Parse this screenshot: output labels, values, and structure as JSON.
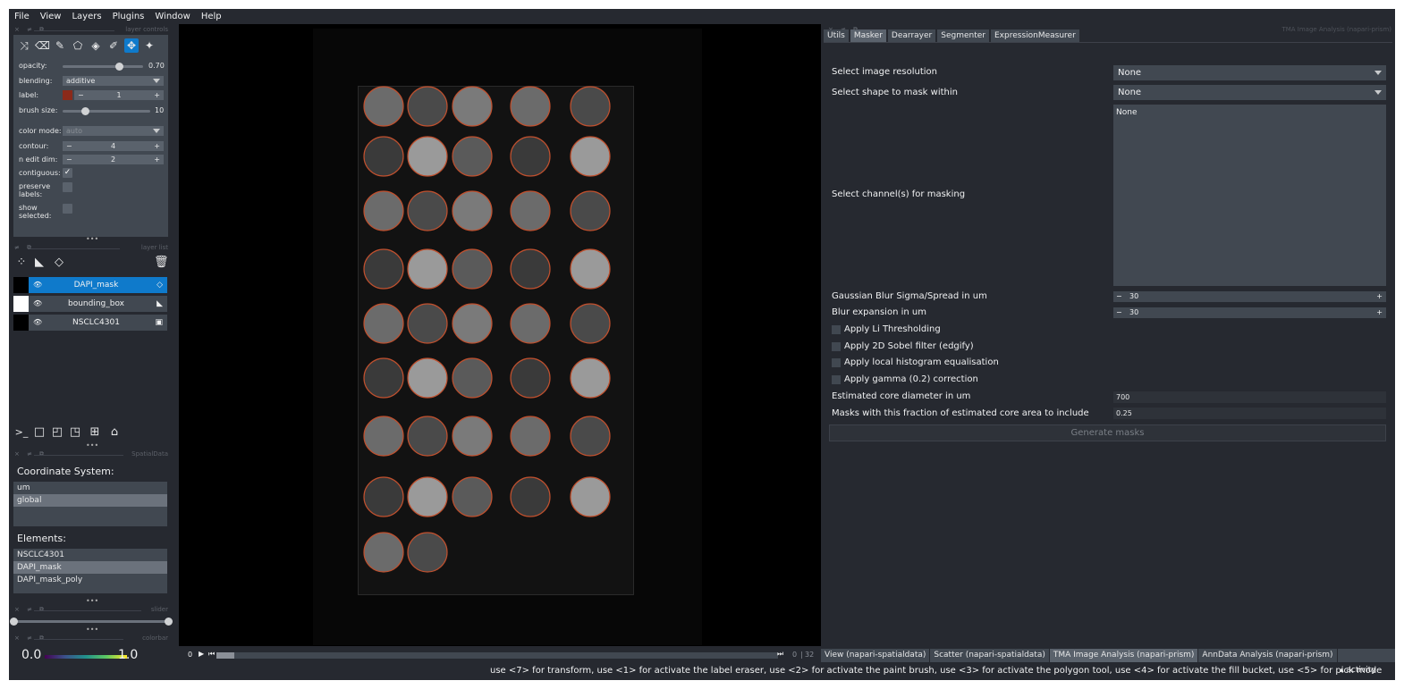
{
  "menu": [
    "File",
    "View",
    "Layers",
    "Plugins",
    "Window",
    "Help"
  ],
  "layer_controls": {
    "title": "layer controls",
    "opacity_label": "opacity:",
    "opacity_value": "0.70",
    "opacity_fraction": 0.7,
    "blending_label": "blending:",
    "blending_value": "additive",
    "label_label": "label:",
    "label_value": "1",
    "label_color": "#8b2a1a",
    "brush_label": "brush size:",
    "brush_value": "10",
    "brush_fraction": 0.25,
    "color_mode_label": "color mode:",
    "color_mode_value": "auto",
    "contour_label": "contour:",
    "contour_value": "4",
    "n_edit_label": "n edit dim:",
    "n_edit_value": "2",
    "contiguous_label": "contiguous:",
    "preserve_label": "preserve labels:",
    "show_selected_label": "show selected:",
    "minus": "−",
    "plus": "+",
    "check": "✓"
  },
  "layer_list": {
    "title": "layer list",
    "layers": [
      {
        "name": "DAPI_mask",
        "type": "labels-icon",
        "selected": true
      },
      {
        "name": "bounding_box",
        "type": "shapes-icon",
        "selected": false
      },
      {
        "name": "NSCLC4301",
        "type": "image-icon",
        "selected": false
      }
    ]
  },
  "spatialdata": {
    "title": "SpatialData",
    "coord_title": "Coordinate System:",
    "coords": [
      "um",
      "global"
    ],
    "coord_selected": "global",
    "elements_title": "Elements:",
    "elements": [
      "NSCLC4301",
      "DAPI_mask",
      "DAPI_mask_poly"
    ],
    "element_selected": "DAPI_mask"
  },
  "slider_dock": {
    "title": "slider"
  },
  "colorbar_dock": {
    "title": "colorbar",
    "min": "0.0",
    "max": "1.0"
  },
  "dims": {
    "start": "0",
    "pos": "0",
    "total": "32",
    "sep": "|"
  },
  "right_dock": {
    "title": "TMA Image Analysis (napari-prism)",
    "tabs": [
      "Utils",
      "Masker",
      "Dearrayer",
      "Segmenter",
      "ExpressionMeasurer"
    ],
    "active_tab": "Masker",
    "resolution_label": "Select image resolution",
    "resolution_value": "None",
    "shape_label": "Select shape to mask within",
    "shape_value": "None",
    "channel_label": "Select channel(s) for masking",
    "channel_value": "None",
    "blur_label": "Gaussian Blur Sigma/Spread in um",
    "blur_value": "30",
    "expansion_label": "Blur expansion in um",
    "expansion_value": "30",
    "checks": [
      "Apply Li Thresholding",
      "Apply 2D Sobel filter (edgify)",
      "Apply local histogram equalisation",
      "Apply gamma (0.2) correction"
    ],
    "core_diam_label": "Estimated core diameter in um",
    "core_diam_value": "700",
    "fraction_label": "Masks with this fraction of estimated core area to include",
    "fraction_value": "0.25",
    "generate_label": "Generate masks"
  },
  "bottom_tabs": [
    "View (napari-spatialdata)",
    "Scatter (napari-spatialdata)",
    "TMA Image Analysis (napari-prism)",
    "AnnData Analysis (napari-prism)"
  ],
  "bottom_active": "TMA Image Analysis (napari-prism)",
  "status": {
    "hint": "use <7> for transform, use <1> for activate the label eraser, use <2> for activate the paint brush, use <3> for activate the polygon tool, use <4> for activate the fill bucket, use <5> for pick mode",
    "activity": "▴ activity"
  },
  "colors": {
    "bg": "#262930",
    "panel": "#414851",
    "accent": "#0f7acb",
    "mask_contour": "#c0502e"
  }
}
